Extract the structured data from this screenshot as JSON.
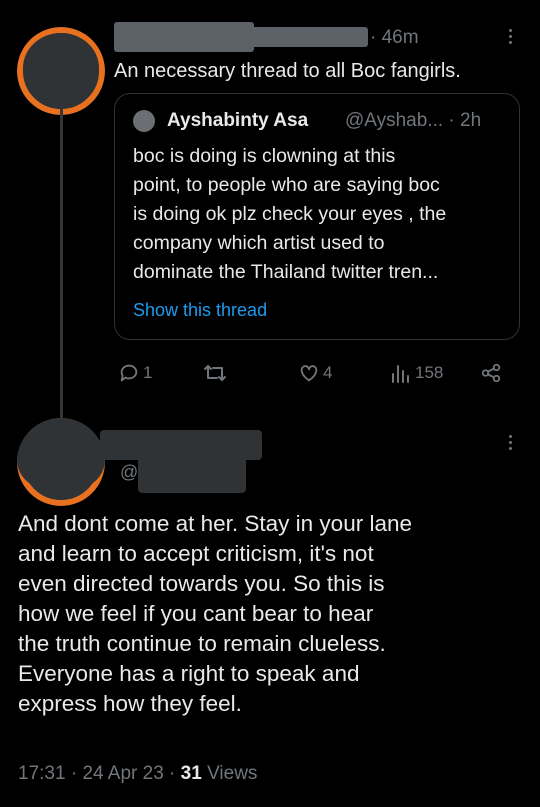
{
  "reply": {
    "time": "46m",
    "text": "An necessary thread to all Boc fangirls."
  },
  "quote": {
    "name": "Ayshabinty Asa",
    "handle_time": "@Ayshab... · 2h",
    "lines": [
      "boc is doing is clowning at this",
      "point, to people who are saying boc",
      "is doing ok plz check your eyes  , the",
      "company which artist used to",
      "dominate the Thailand twitter tren..."
    ],
    "show_thread": "Show this thread"
  },
  "actions": {
    "replies": "1",
    "retweets": "",
    "likes": "4",
    "views": "158"
  },
  "main_tweet": {
    "handle_prefix": "@",
    "lines": [
      "And dont come at her. Stay in your lane",
      "and learn to accept criticism, it's not",
      "even directed towards you. So this is",
      "how we feel if you cant bear to hear",
      "the truth continue to remain clueless.",
      "Everyone has a right to speak and",
      "express how they feel."
    ],
    "time": "17:31",
    "date": "24 Apr 23",
    "views_count": "31",
    "views_label": "Views"
  },
  "colors": {
    "background": "#000000",
    "text": "#e7e9ea",
    "muted": "#71767b",
    "link": "#1d9bf0",
    "avatar_ring": "#e8701e"
  },
  "icons": [
    "reply-icon",
    "retweet-icon",
    "like-icon",
    "views-icon",
    "share-icon",
    "more-icon"
  ]
}
